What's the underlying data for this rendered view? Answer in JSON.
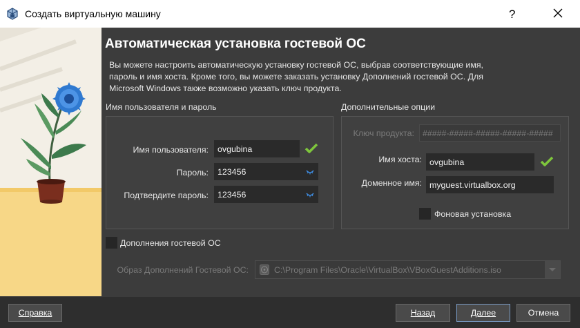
{
  "window": {
    "title": "Создать виртуальную машину",
    "help_glyph": "?",
    "app_icon": "virtualbox-icon"
  },
  "page": {
    "title": "Автоматическая установка гостевой ОС",
    "description_lines": [
      "Вы можете настроить автоматическую установку гостевой ОС, выбрав соответствующие имя,",
      "пароль и имя хоста. Кроме того, вы можете заказать установку Дополнений гостевой ОС. Для",
      "Microsoft Windows также возможно указать ключ продукта."
    ]
  },
  "user_group": {
    "title": "Имя пользователя и пароль",
    "username_label": "Имя пользователя:",
    "username_value": "ovgubina",
    "password_label": "Пароль:",
    "password_value": "123456",
    "confirm_label": "Подтвердите пароль:",
    "confirm_value": "123456"
  },
  "extra_group": {
    "title": "Дополнительные опции",
    "product_key_label": "Ключ продукта:",
    "product_key_placeholder": "#####-#####-#####-#####-#####",
    "hostname_label": "Имя хоста:",
    "hostname_value": "ovgubina",
    "domain_label": "Доменное имя:",
    "domain_value": "myguest.virtualbox.org",
    "background_install_label": "Фоновая установка",
    "background_install_checked": false
  },
  "guest_additions": {
    "checkbox_label": "Дополнения гостевой ОС",
    "checked": false,
    "iso_label": "Образ Дополнений Гостевой ОС:",
    "iso_path": "C:\\Program Files\\Oracle\\VirtualBox\\VBoxGuestAdditions.iso"
  },
  "buttons": {
    "help": "Справка",
    "back": "Назад",
    "next": "Далее",
    "cancel": "Отмена"
  },
  "colors": {
    "valid_check": "#7ec63c",
    "panel_bg": "#3c3c3c",
    "field_bg": "#2a2a2a"
  }
}
